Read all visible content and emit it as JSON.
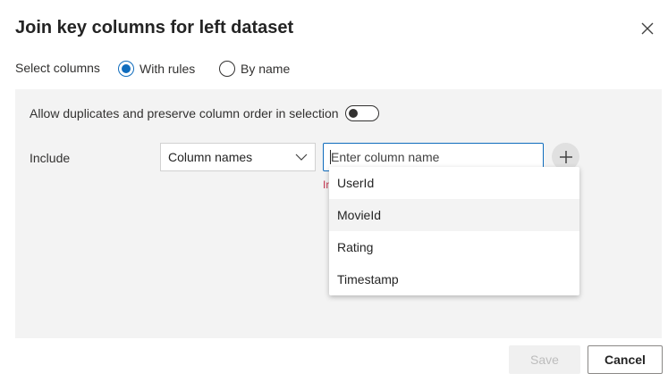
{
  "dialog": {
    "title": "Join key columns for left dataset",
    "close_icon": "close-icon"
  },
  "select_columns": {
    "label": "Select columns",
    "options": [
      {
        "label": "With rules",
        "selected": true
      },
      {
        "label": "By name",
        "selected": false
      }
    ]
  },
  "panel": {
    "toggle_label": "Allow duplicates and preserve column order in selection",
    "toggle_on": false,
    "include_label": "Include",
    "dropdown_value": "Column names",
    "input_placeholder": "Enter column name",
    "input_value": "",
    "error_text": "In",
    "add_icon": "plus-icon"
  },
  "suggestions": [
    "UserId",
    "MovieId",
    "Rating",
    "Timestamp"
  ],
  "footer": {
    "save_label": "Save",
    "cancel_label": "Cancel"
  },
  "colors": {
    "accent": "#0f6cbd",
    "panel_bg": "#f3f3f3",
    "error": "#c4314b"
  }
}
